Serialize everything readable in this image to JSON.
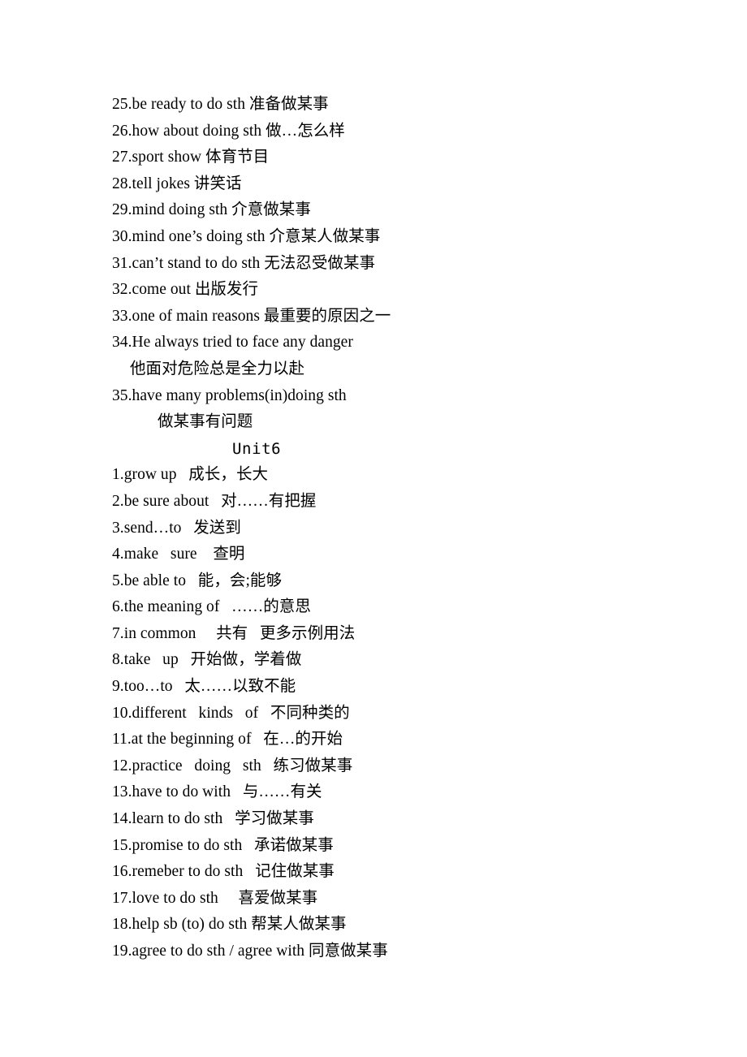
{
  "document": {
    "background_color": "#ffffff",
    "text_color": "#000000",
    "blocks": [
      {
        "id": "unit5-tail",
        "lines": [
          {
            "type": "item",
            "text": "25.be ready to do sth 准备做某事"
          },
          {
            "type": "item",
            "text": "26.how about doing sth 做…怎么样"
          },
          {
            "type": "item",
            "text": "27.sport show 体育节目"
          },
          {
            "type": "item",
            "text": "28.tell jokes 讲笑话"
          },
          {
            "type": "item",
            "text": "29.mind doing sth 介意做某事"
          },
          {
            "type": "item",
            "text": "30.mind one’s doing sth 介意某人做某事"
          },
          {
            "type": "item",
            "text": "31.can’t stand to do sth 无法忍受做某事"
          },
          {
            "type": "item",
            "text": "32.come out 出版发行"
          },
          {
            "type": "item",
            "text": "33.one of main reasons 最重要的原因之一"
          },
          {
            "type": "item",
            "text": "34.He always tried to face any danger"
          },
          {
            "type": "continuation-a",
            "text": "他面对危险总是全力以赴"
          },
          {
            "type": "item",
            "text": "35.have many problems(in)doing sth"
          },
          {
            "type": "continuation-b",
            "text": "做某事有问题"
          }
        ]
      },
      {
        "id": "unit6",
        "heading": "Unit6",
        "lines": [
          {
            "type": "item",
            "text": "1.grow up   成长，长大"
          },
          {
            "type": "item",
            "text": "2.be sure about   对……有把握"
          },
          {
            "type": "item",
            "text": "3.send…to   发送到"
          },
          {
            "type": "item",
            "text": "4.make   sure    查明"
          },
          {
            "type": "item",
            "text": "5.be able to   能，会;能够"
          },
          {
            "type": "item",
            "text": "6.the meaning of   ……的意思"
          },
          {
            "type": "item",
            "text": "7.in common     共有   更多示例用法"
          },
          {
            "type": "item",
            "text": "8.take   up   开始做，学着做"
          },
          {
            "type": "item",
            "text": "9.too…to   太……以致不能"
          },
          {
            "type": "item",
            "text": "10.different   kinds   of   不同种类的"
          },
          {
            "type": "item",
            "text": "11.at the beginning of   在…的开始"
          },
          {
            "type": "item",
            "text": "12.practice   doing   sth   练习做某事"
          },
          {
            "type": "item",
            "text": "13.have to do with   与……有关"
          },
          {
            "type": "item",
            "text": "14.learn to do sth   学习做某事"
          },
          {
            "type": "item",
            "text": "15.promise to do sth   承诺做某事"
          },
          {
            "type": "item",
            "text": "16.remeber to do sth   记住做某事"
          },
          {
            "type": "item",
            "text": "17.love to do sth     喜爱做某事"
          },
          {
            "type": "item",
            "text": "18.help sb (to) do sth 帮某人做某事"
          },
          {
            "type": "item",
            "text": "19.agree to do sth / agree with 同意做某事"
          }
        ]
      }
    ]
  }
}
